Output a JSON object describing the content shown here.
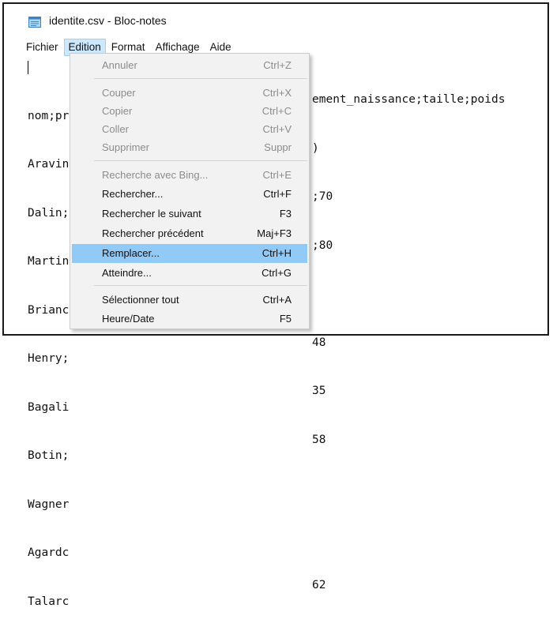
{
  "window": {
    "title": "identite.csv - Bloc-notes",
    "icon": "notepad-icon"
  },
  "menubar": {
    "items": [
      "Fichier",
      "Edition",
      "Format",
      "Affichage",
      "Aide"
    ],
    "active": "Edition"
  },
  "editor": {
    "lines": [
      "nom;pr",
      "Aravin",
      "Dalin;",
      "Martin",
      "Brianc",
      "Henry;",
      "Bagali",
      "Botin;",
      "Wagner",
      "Agardc",
      "Talarc"
    ],
    "visible_tails": [
      "ement_naissance;taille;poids",
      ")",
      ";70",
      ";80",
      "",
      "48",
      "35",
      "58",
      "",
      "",
      "62"
    ]
  },
  "edition_menu": {
    "items": [
      {
        "label": "Annuler",
        "shortcut": "Ctrl+Z",
        "enabled": false
      },
      {
        "label": "Couper",
        "shortcut": "Ctrl+X",
        "enabled": false
      },
      {
        "label": "Copier",
        "shortcut": "Ctrl+C",
        "enabled": false
      },
      {
        "label": "Coller",
        "shortcut": "Ctrl+V",
        "enabled": false
      },
      {
        "label": "Supprimer",
        "shortcut": "Suppr",
        "enabled": false
      },
      {
        "label": "Recherche avec Bing...",
        "shortcut": "Ctrl+E",
        "enabled": false
      },
      {
        "label": "Rechercher...",
        "shortcut": "Ctrl+F",
        "enabled": true
      },
      {
        "label": "Rechercher le suivant",
        "shortcut": "F3",
        "enabled": true
      },
      {
        "label": "Rechercher précédent",
        "shortcut": "Maj+F3",
        "enabled": true
      },
      {
        "label": "Remplacer...",
        "shortcut": "Ctrl+H",
        "enabled": true,
        "highlighted": true
      },
      {
        "label": "Atteindre...",
        "shortcut": "Ctrl+G",
        "enabled": true
      },
      {
        "label": "Sélectionner tout",
        "shortcut": "Ctrl+A",
        "enabled": true
      },
      {
        "label": "Heure/Date",
        "shortcut": "F5",
        "enabled": true
      }
    ]
  },
  "colors": {
    "menu_highlight": "#91c9f7",
    "active_menu_bg": "#cce8ff",
    "disabled_text": "#8c8c8c"
  }
}
